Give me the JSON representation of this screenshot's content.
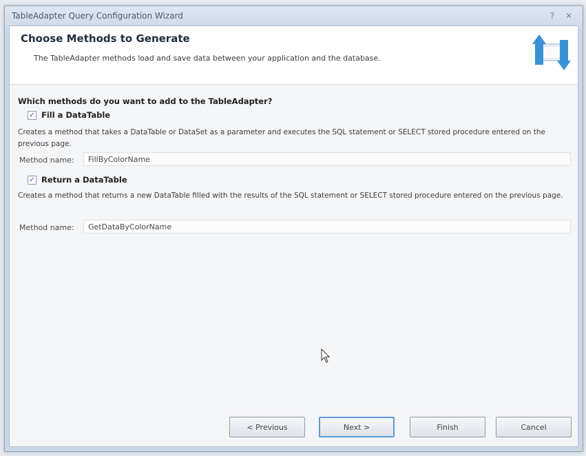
{
  "window": {
    "title": "TableAdapter Query Configuration Wizard",
    "help_icon": "question-icon",
    "close_icon": "close-icon"
  },
  "header": {
    "title": "Choose Methods to Generate",
    "subtitle": "The TableAdapter methods load and save data between your application and the database.",
    "icon": "tableadapter-arrows-icon"
  },
  "content": {
    "question": "Which methods do you want to add to the TableAdapter?",
    "fill": {
      "checked": true,
      "label": "Fill a DataTable",
      "description": "Creates a method that takes a DataTable or DataSet as a parameter and executes the SQL statement or SELECT stored procedure entered on the previous page.",
      "method_label": "Method name:",
      "method_value": "FillByColorName"
    },
    "return": {
      "checked": true,
      "label": "Return a DataTable",
      "description": "Creates a method that returns a new DataTable filled with the results of the SQL statement or SELECT stored procedure entered on the previous page.",
      "method_label": "Method name:",
      "method_value": "GetDataByColorName"
    }
  },
  "buttons": {
    "previous": "< Previous",
    "next": "Next >",
    "finish": "Finish",
    "cancel": "Cancel"
  },
  "colors": {
    "accent": "#5f9bd6",
    "icon_blue": "#3a92d6"
  }
}
